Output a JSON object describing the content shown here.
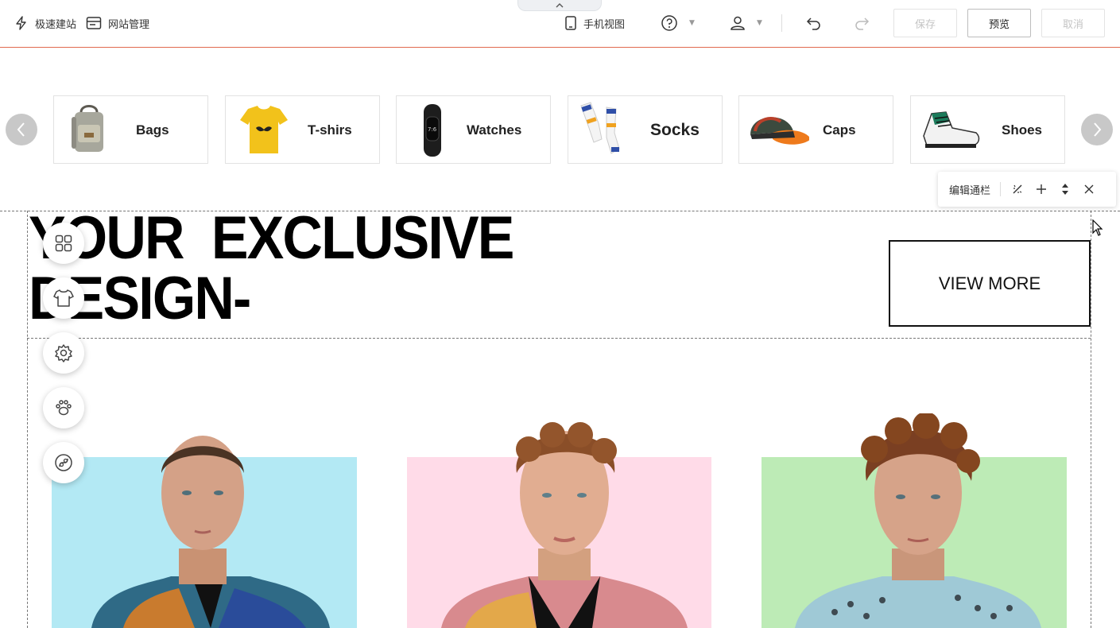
{
  "toolbar": {
    "quick_build": "极速建站",
    "site_manage": "网站管理",
    "mobile_view": "手机视图",
    "save": "保存",
    "preview": "预览",
    "cancel": "取消"
  },
  "categories": [
    {
      "label": "Bags"
    },
    {
      "label": "T-shirs"
    },
    {
      "label": "Watches"
    },
    {
      "label": "Socks"
    },
    {
      "label": "Caps"
    },
    {
      "label": "Shoes"
    }
  ],
  "edit_bar": {
    "label": "编辑通栏"
  },
  "hero": {
    "headline": "YOUR  EXCLUSIVE\nDESIGN-",
    "view_more": "VIEW MORE"
  },
  "colors": {
    "accent_line": "#e06a4f",
    "panel_blue": "#b3e9f4",
    "panel_pink": "#ffdbe8",
    "panel_green": "#bdebb6"
  }
}
